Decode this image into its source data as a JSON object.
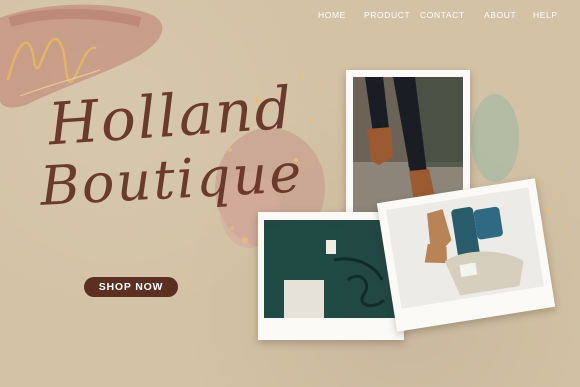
{
  "nav": {
    "items": [
      {
        "label": "HOME"
      },
      {
        "label": "PRODUCT"
      },
      {
        "label": "CONTACT"
      },
      {
        "label": "ABOUT"
      },
      {
        "label": "HELP"
      }
    ]
  },
  "hero": {
    "title_line1": "Holland",
    "title_line2": "Boutique",
    "cta_label": "SHOP NOW"
  },
  "colors": {
    "background": "#d3c2a6",
    "cta": "#5b2f22",
    "title": "#6a3a2c",
    "nav_text": "#ffffff"
  },
  "photos": [
    {
      "subject": "legs-in-ankle-boots"
    },
    {
      "subject": "person-in-green-sweater-holding-cup"
    },
    {
      "subject": "flatlay-boots-and-sweaters"
    }
  ]
}
